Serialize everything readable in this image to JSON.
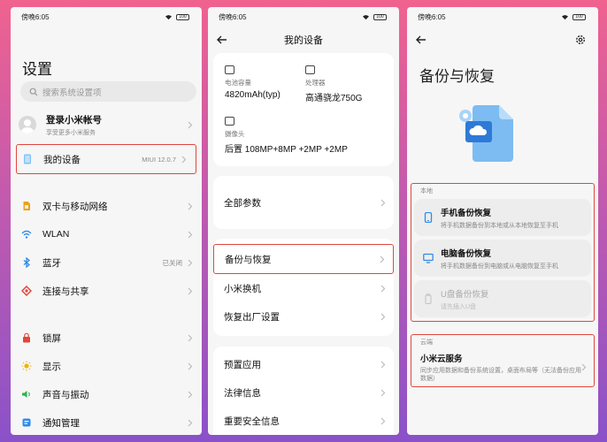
{
  "status": {
    "time": "傍晚6:05",
    "battery": "100"
  },
  "settings": {
    "title": "设置",
    "search_placeholder": "搜索系统设置项",
    "account_title": "登录小米帐号",
    "account_sub": "享受更多小米服务",
    "my_device": {
      "label": "我的设备",
      "value": "MIUI 12.0.7"
    },
    "group1": [
      {
        "label": "双卡与移动网络",
        "value": "",
        "icon": "sim-card-icon",
        "color": "#e9a21d"
      },
      {
        "label": "WLAN",
        "value": "",
        "icon": "wifi-icon",
        "color": "#2f8bea"
      },
      {
        "label": "蓝牙",
        "value": "已关闭",
        "icon": "bluetooth-icon",
        "color": "#2f8bea"
      },
      {
        "label": "连接与共享",
        "value": "",
        "icon": "share-icon",
        "color": "#e0473d"
      }
    ],
    "group2": [
      {
        "label": "锁屏",
        "icon": "lock-icon",
        "color": "#e0473d"
      },
      {
        "label": "显示",
        "icon": "sun-icon",
        "color": "#f0b400"
      },
      {
        "label": "声音与振动",
        "icon": "speaker-icon",
        "color": "#2cb34a"
      },
      {
        "label": "通知管理",
        "icon": "bell-icon",
        "color": "#2f8bea"
      }
    ]
  },
  "device": {
    "title": "我的设备",
    "battery": {
      "label": "电池容量",
      "value": "4820mAh(typ)"
    },
    "cpu": {
      "label": "处理器",
      "value": "高通骁龙750G"
    },
    "camera": {
      "label": "摄像头",
      "value": "后置 108MP+8MP +2MP +2MP"
    },
    "all_params": "全部参数",
    "group1": [
      "备份与恢复",
      "小米换机",
      "恢复出厂设置"
    ],
    "group2": [
      "预置应用",
      "法律信息",
      "重要安全信息"
    ]
  },
  "backup": {
    "title": "备份与恢复",
    "local_label": "本地",
    "phone_title": "手机备份恢复",
    "phone_sub": "将手机数据备份到本地或从本地恢复至手机",
    "pc_title": "电脑备份恢复",
    "pc_sub": "将手机数据备份到电脑或从电脑恢复至手机",
    "usb_title": "U盘备份恢复",
    "usb_sub": "请先插入U盘",
    "cloud_label": "云端",
    "cloud_title": "小米云服务",
    "cloud_sub": "同步应用数据和备份系统设置，桌面布局等（无法备份应用数据）"
  },
  "colors": {
    "highlight": "#e0473d",
    "accent": "#2f8bea"
  }
}
